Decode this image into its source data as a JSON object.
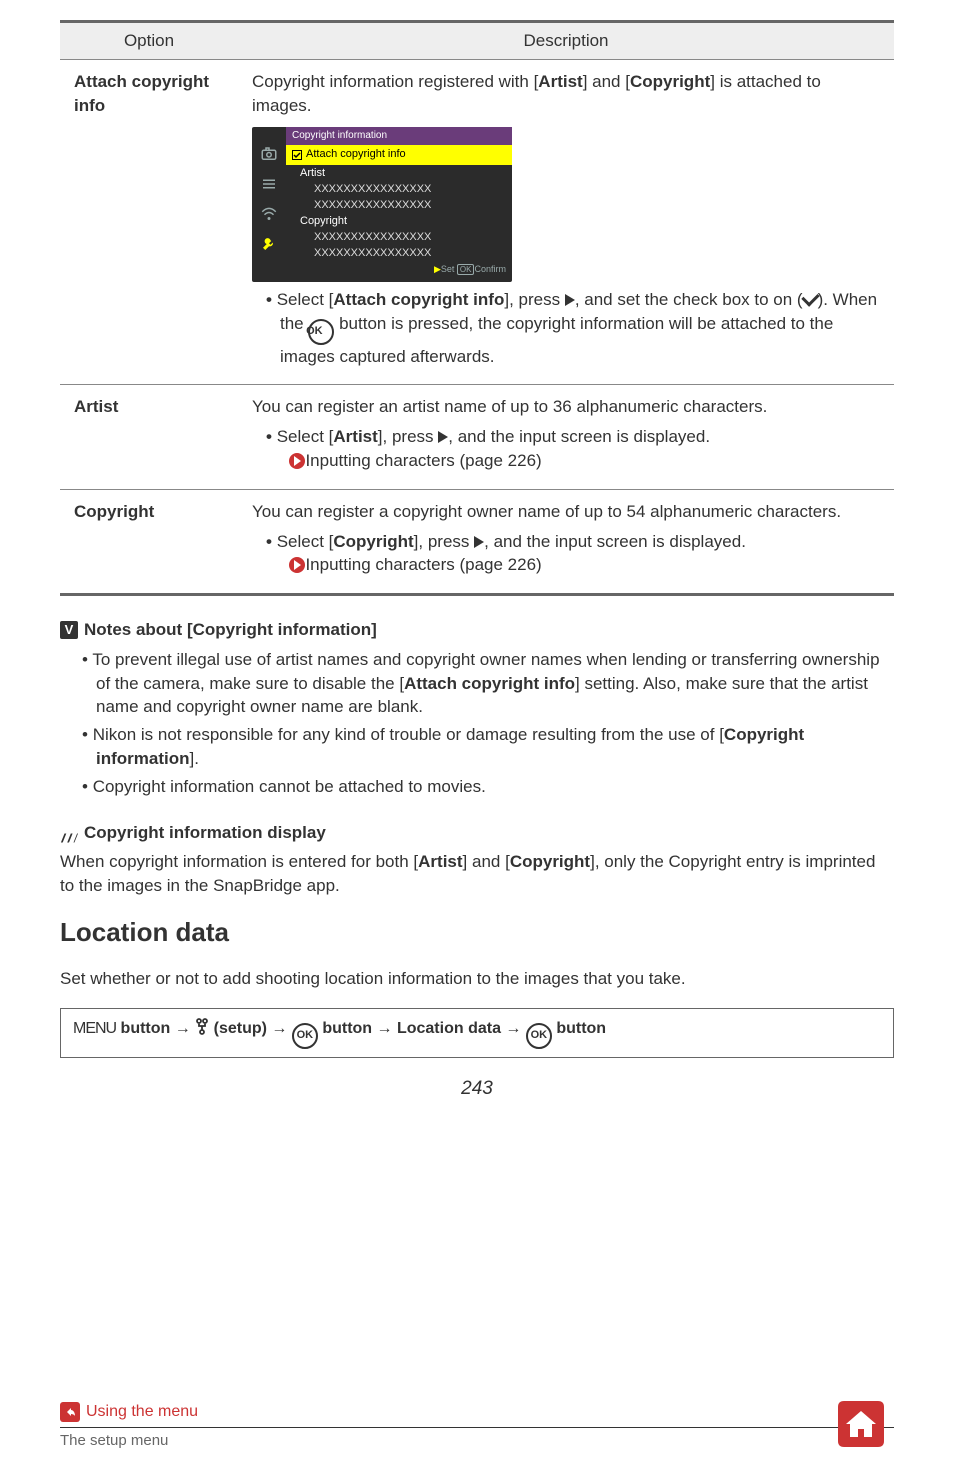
{
  "table": {
    "headers": {
      "option": "Option",
      "description": "Description"
    },
    "rows": {
      "attach": {
        "label": "Attach copyright info",
        "intro_a": "Copyright information registered with [",
        "intro_b": "Artist",
        "intro_c": "] and [",
        "intro_d": "Copyright",
        "intro_e": "] is attached to images.",
        "panel": {
          "title": "Copyright information",
          "hl": "Attach copyright info",
          "artist_label": "Artist",
          "artist_val": "XXXXXXXXXXXXXXXX",
          "artist_val2": "XXXXXXXXXXXXXXXX",
          "copy_label": "Copyright",
          "copy_val": "XXXXXXXXXXXXXXXX",
          "copy_val2": "XXXXXXXXXXXXXXXX",
          "foot_set": "Set",
          "foot_ok": "Confirm"
        },
        "bullet_a": "Select [",
        "bullet_b": "Attach copyright info",
        "bullet_c": "], press ",
        "bullet_d": ", and set the check box to on (",
        "bullet_e": "). When the ",
        "bullet_f": " button is pressed, the copyright information will be attached to the images captured afterwards."
      },
      "artist": {
        "label": "Artist",
        "desc": "You can register an artist name of up to 36 alphanumeric characters.",
        "b_a": "Select [",
        "b_b": "Artist",
        "b_c": "], press ",
        "b_d": ", and the input screen is displayed.",
        "link": "Inputting characters (page 226)"
      },
      "copyright": {
        "label": "Copyright",
        "desc": "You can register a copyright owner name of up to 54 alphanumeric characters.",
        "b_a": "Select [",
        "b_b": "Copyright",
        "b_c": "], press ",
        "b_d": ", and the input screen is displayed.",
        "link": "Inputting characters (page 226)"
      }
    }
  },
  "notes": {
    "h1": "Notes about [Copyright information]",
    "li1_a": "To prevent illegal use of artist names and copyright owner names when lending or transferring ownership of the camera, make sure to disable the [",
    "li1_b": "Attach copyright info",
    "li1_c": "] setting. Also, make sure that the artist name and copyright owner name are blank.",
    "li2_a": "Nikon is not responsible for any kind of trouble or damage resulting from the use of [",
    "li2_b": "Copyright information",
    "li2_c": "].",
    "li3": "Copyright information cannot be attached to movies.",
    "h2": "Copyright information display",
    "p2_a": "When copyright information is entered for both [",
    "p2_b": "Artist",
    "p2_c": "] and [",
    "p2_d": "Copyright",
    "p2_e": "], only the Copyright entry is imprinted to the images in the SnapBridge app."
  },
  "loc": {
    "h": "Location data",
    "p": "Set whether or not to add shooting location information to the images that you take.",
    "path_menu": "MENU",
    "path_a": " button ",
    "path_b": " (setup) ",
    "path_c": " button ",
    "path_d": " Location data ",
    "path_e": " button"
  },
  "ok": "OK",
  "page": "243",
  "footer": {
    "link": "Using the menu",
    "sub": "The setup menu"
  }
}
